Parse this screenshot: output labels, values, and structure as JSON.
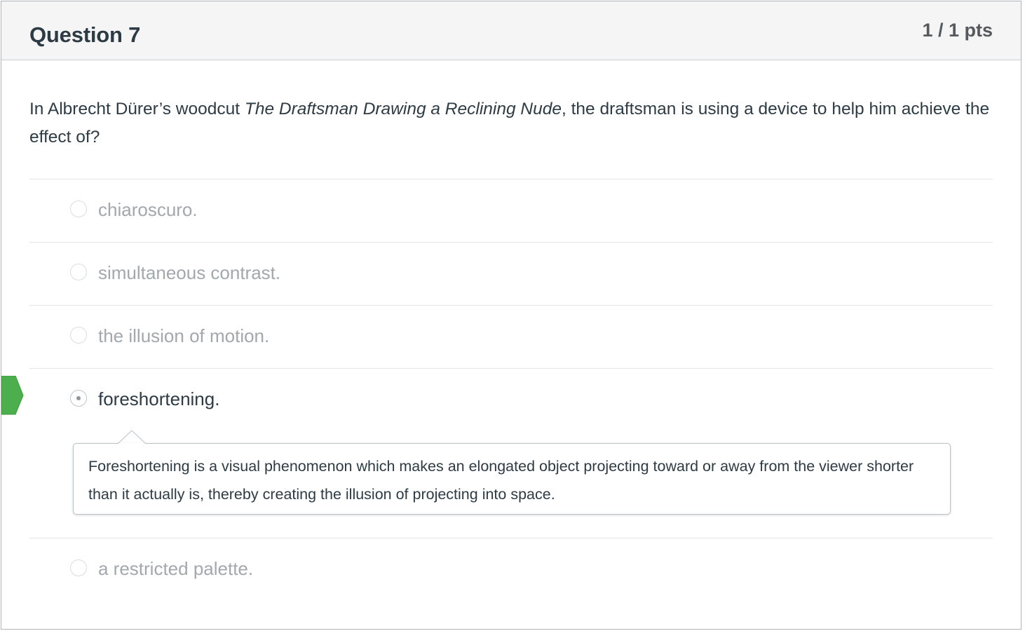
{
  "question": {
    "title": "Question 7",
    "points": "1 / 1 pts",
    "text_before": "In Albrecht Dürer’s woodcut ",
    "text_italic": "The Draftsman Drawing a Reclining Nude",
    "text_after": ", the draftsman is using a device to help him achieve the effect of?"
  },
  "answers": [
    {
      "label": "chiaroscuro.",
      "selected": false
    },
    {
      "label": "simultaneous contrast.",
      "selected": false
    },
    {
      "label": "the illusion of motion.",
      "selected": false
    },
    {
      "label": "foreshortening.",
      "selected": true
    },
    {
      "label": "a restricted palette.",
      "selected": false
    }
  ],
  "comment": {
    "text": "Foreshortening is a visual phenomenon which makes an elongated object projecting toward or away from the viewer shorter than it actually is, thereby creating the illusion of projecting into space."
  },
  "colors": {
    "correct_marker": "#4cae4c",
    "header_bg": "#f5f5f5",
    "text": "#2d3b45",
    "unselected_text": "#a3a8ad"
  },
  "icons": {
    "correct_marker": "correct-answer-arrow-icon",
    "radio": "radio-button-icon"
  }
}
